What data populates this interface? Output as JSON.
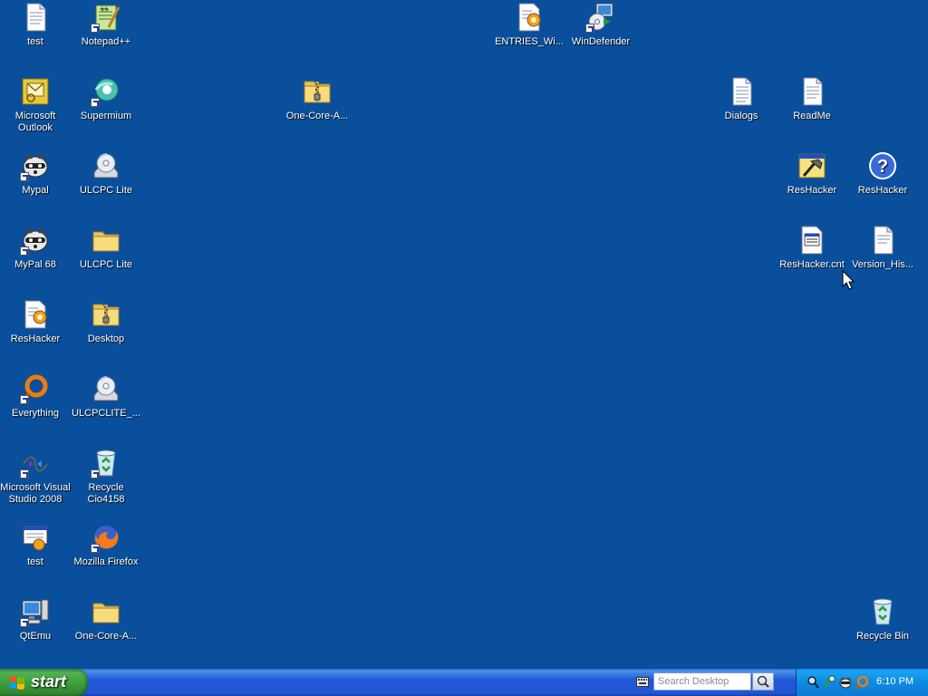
{
  "desktop": {
    "icons": [
      {
        "name": "test",
        "label": "test"
      },
      {
        "name": "notepad-plus-plus",
        "label": "Notepad++"
      },
      {
        "name": "entries-wi",
        "label": "ENTRIES_Wi..."
      },
      {
        "name": "windefender",
        "label": "WinDefender"
      },
      {
        "name": "microsoft-outlook",
        "label": "Microsoft Outlook"
      },
      {
        "name": "supermium",
        "label": "Supermium"
      },
      {
        "name": "one-core-a-zip",
        "label": "One-Core-A..."
      },
      {
        "name": "dialogs",
        "label": "Dialogs"
      },
      {
        "name": "readme",
        "label": "ReadMe"
      },
      {
        "name": "mypal",
        "label": "Mypal"
      },
      {
        "name": "ulcpc-lite-disc",
        "label": "ULCPC Lite"
      },
      {
        "name": "reshacker-app",
        "label": "ResHacker"
      },
      {
        "name": "reshacker-help",
        "label": "ResHacker"
      },
      {
        "name": "mypal-68",
        "label": "MyPal 68"
      },
      {
        "name": "ulcpc-lite-folder",
        "label": "ULCPC Lite"
      },
      {
        "name": "reshacker-cnt",
        "label": "ResHacker.cnt"
      },
      {
        "name": "version-his",
        "label": "Version_His..."
      },
      {
        "name": "reshacker-setup",
        "label": "ResHacker"
      },
      {
        "name": "desktop-zip",
        "label": "Desktop"
      },
      {
        "name": "everything",
        "label": "Everything"
      },
      {
        "name": "ulcpclite-disc",
        "label": "ULCPCLITE_..."
      },
      {
        "name": "visual-studio-2008",
        "label": "Microsoft Visual Studio 2008"
      },
      {
        "name": "recycle-cio4158",
        "label": "Recycle Cio4158"
      },
      {
        "name": "test-2",
        "label": "test"
      },
      {
        "name": "mozilla-firefox",
        "label": "Mozilla Firefox"
      },
      {
        "name": "qtemu",
        "label": "QtEmu"
      },
      {
        "name": "one-core-a-folder",
        "label": "One-Core-A..."
      },
      {
        "name": "recycle-bin",
        "label": "Recycle Bin"
      }
    ]
  },
  "taskbar": {
    "start_label": "start",
    "search_placeholder": "Search Desktop",
    "clock": "6:10 PM"
  },
  "colors": {
    "desktop_background": "#0a4f9c",
    "taskbar": "#2157d7",
    "start_button": "#3a9a3a",
    "tray": "#0e8ae2"
  }
}
